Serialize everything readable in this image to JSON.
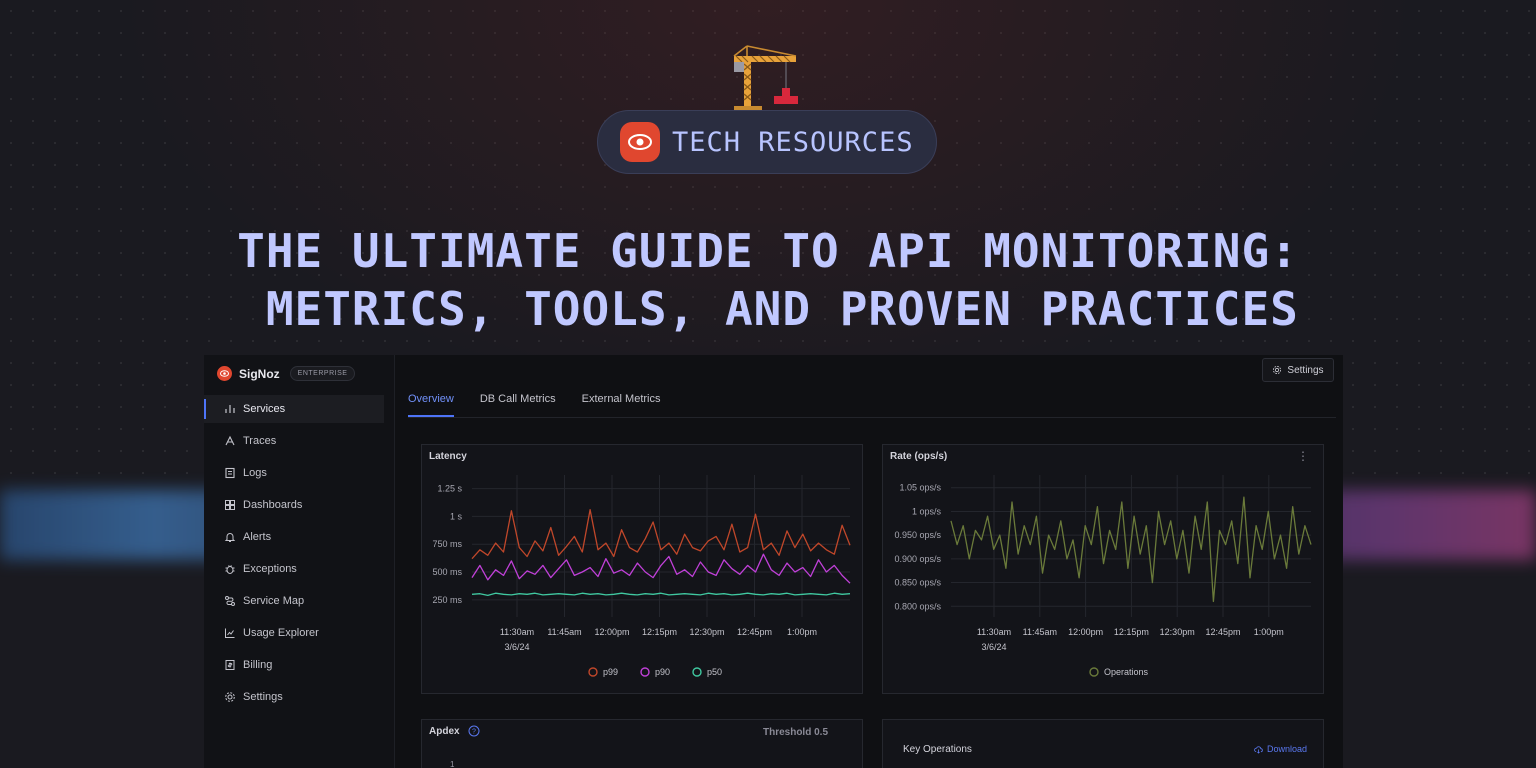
{
  "hero": {
    "badge_text": "TECH RESOURCES",
    "headline_line1": "THE ULTIMATE GUIDE TO API MONITORING:",
    "headline_line2": " METRICS, TOOLS, AND PROVEN PRACTICES"
  },
  "app": {
    "brand_name": "SigNoz",
    "brand_tag": "ENTERPRISE",
    "settings_button": "Settings",
    "sidebar": {
      "items": [
        {
          "label": "Services",
          "icon": "bar-chart-icon",
          "active": true
        },
        {
          "label": "Traces",
          "icon": "traces-icon"
        },
        {
          "label": "Logs",
          "icon": "logs-icon"
        },
        {
          "label": "Dashboards",
          "icon": "dashboards-icon"
        },
        {
          "label": "Alerts",
          "icon": "bell-icon"
        },
        {
          "label": "Exceptions",
          "icon": "bug-icon"
        },
        {
          "label": "Service Map",
          "icon": "route-icon"
        },
        {
          "label": "Usage Explorer",
          "icon": "usage-chart-icon"
        },
        {
          "label": "Billing",
          "icon": "receipt-icon"
        },
        {
          "label": "Settings",
          "icon": "gear-icon"
        }
      ]
    },
    "tabs": [
      {
        "label": "Overview",
        "active": true
      },
      {
        "label": "DB Call Metrics"
      },
      {
        "label": "External Metrics"
      }
    ],
    "apdex": {
      "title": "Apdex",
      "threshold": "Threshold 0.5",
      "first_tick": "1"
    },
    "key_operations": {
      "title": "Key Operations",
      "download": "Download"
    }
  },
  "colors": {
    "accent": "#4e74f8",
    "brand": "#e0472f",
    "p99": "#c0472a",
    "p90": "#c040d8",
    "p50": "#40c8a0",
    "operations": "#6a7a3a"
  },
  "chart_data": [
    {
      "type": "line",
      "title": "Latency",
      "x_ticks": [
        "11:30am",
        "11:45am",
        "12:00pm",
        "12:15pm",
        "12:30pm",
        "12:45pm",
        "1:00pm"
      ],
      "x_date": "3/6/24",
      "y_ticks": [
        "1.25 s",
        "1 s",
        "750 ms",
        "500 ms",
        "250 ms"
      ],
      "y_tick_values": [
        1250,
        1000,
        750,
        500,
        250
      ],
      "ylim": [
        150,
        1300
      ],
      "legend": [
        "p99",
        "p90",
        "p50"
      ],
      "legend_position": "bottom",
      "grid": true,
      "series": [
        {
          "name": "p99",
          "values": [
            620,
            700,
            650,
            760,
            680,
            1050,
            720,
            640,
            780,
            690,
            900,
            650,
            730,
            820,
            680,
            1060,
            700,
            760,
            640,
            880,
            720,
            680,
            800,
            950,
            700,
            760,
            660,
            840,
            720,
            690,
            780,
            820,
            700,
            930,
            680,
            720,
            1020,
            700,
            760,
            650,
            870,
            720,
            840,
            690,
            760,
            700,
            660,
            920,
            740
          ]
        },
        {
          "name": "p90",
          "values": [
            450,
            560,
            430,
            520,
            470,
            600,
            440,
            510,
            480,
            560,
            450,
            530,
            610,
            470,
            500,
            540,
            460,
            620,
            490,
            520,
            470,
            580,
            500,
            450,
            560,
            640,
            480,
            520,
            460,
            590,
            500,
            470,
            610,
            530,
            480,
            560,
            500,
            660,
            520,
            470,
            580,
            500,
            540,
            460,
            610,
            500,
            560,
            470,
            400
          ]
        },
        {
          "name": "p50",
          "values": [
            300,
            305,
            290,
            310,
            300,
            295,
            305,
            300,
            310,
            295,
            300,
            305,
            300,
            295,
            310,
            300,
            305,
            295,
            300,
            310,
            300,
            295,
            305,
            300,
            310,
            295,
            300,
            305,
            300,
            295,
            310,
            300,
            305,
            295,
            300,
            310,
            300,
            295,
            305,
            300,
            310,
            295,
            300,
            305,
            300,
            295,
            310,
            300,
            305
          ]
        }
      ]
    },
    {
      "type": "line",
      "title": "Rate (ops/s)",
      "x_ticks": [
        "11:30am",
        "11:45am",
        "12:00pm",
        "12:15pm",
        "12:30pm",
        "12:45pm",
        "1:00pm"
      ],
      "x_date": "3/6/24",
      "y_ticks": [
        "1.05 ops/s",
        "1 ops/s",
        "0.950 ops/s",
        "0.900 ops/s",
        "0.850 ops/s",
        "0.800 ops/s"
      ],
      "y_tick_values": [
        1.05,
        1.0,
        0.95,
        0.9,
        0.85,
        0.8
      ],
      "ylim": [
        0.79,
        1.06
      ],
      "legend": [
        "Operations"
      ],
      "legend_position": "bottom",
      "grid": true,
      "series": [
        {
          "name": "Operations",
          "values": [
            0.98,
            0.93,
            0.97,
            0.9,
            0.96,
            0.94,
            0.99,
            0.92,
            0.95,
            0.88,
            1.02,
            0.91,
            0.97,
            0.93,
            0.99,
            0.87,
            0.95,
            0.92,
            0.98,
            0.9,
            0.94,
            0.86,
            0.97,
            0.93,
            1.01,
            0.89,
            0.96,
            0.92,
            1.02,
            0.88,
            0.99,
            0.91,
            0.97,
            0.85,
            1.0,
            0.93,
            0.98,
            0.9,
            0.96,
            0.87,
            0.99,
            0.92,
            1.02,
            0.81,
            0.96,
            0.93,
            0.98,
            0.89,
            1.03,
            0.86,
            0.97,
            0.92,
            1.0,
            0.9,
            0.95,
            0.88,
            1.01,
            0.91,
            0.97,
            0.93
          ]
        }
      ]
    }
  ]
}
